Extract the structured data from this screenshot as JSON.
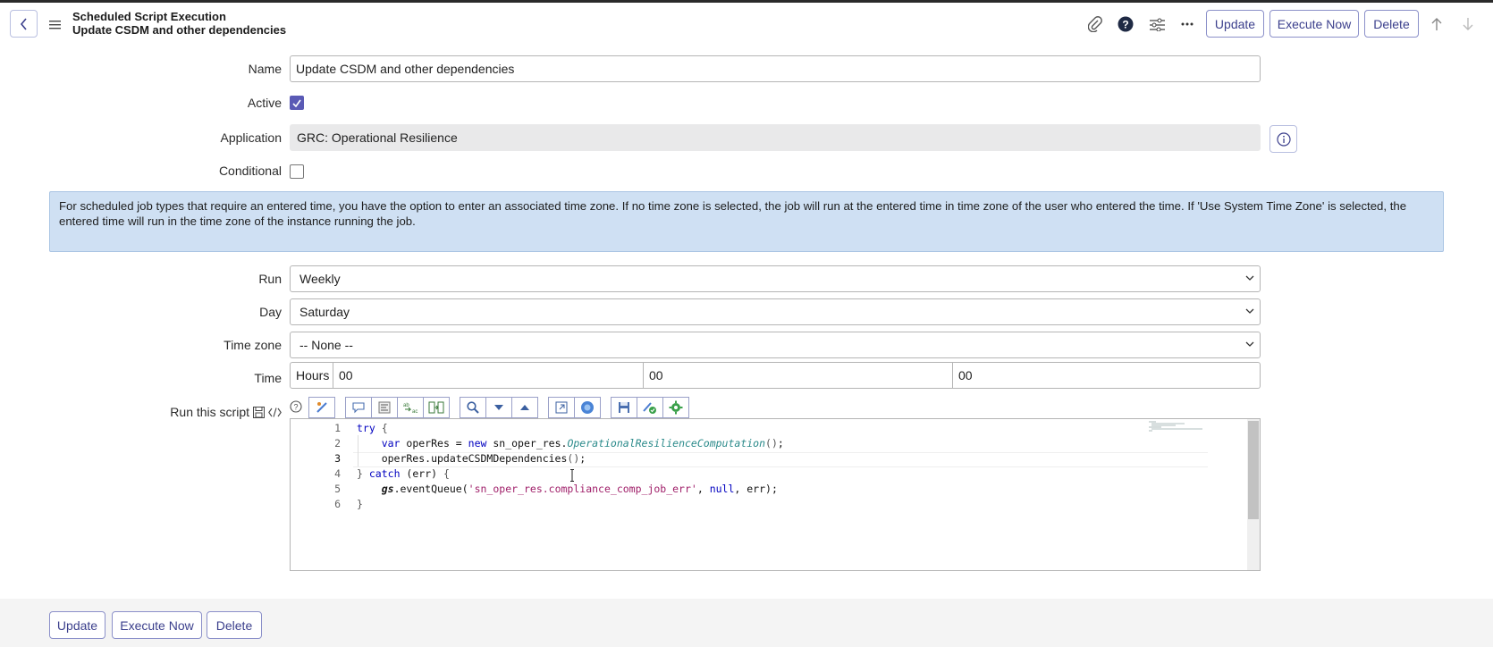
{
  "header": {
    "title": "Scheduled Script Execution",
    "subtitle": "Update CSDM and other dependencies",
    "buttons": {
      "update": "Update",
      "execute_now": "Execute Now",
      "delete": "Delete"
    }
  },
  "form": {
    "name": {
      "label": "Name",
      "value": "Update CSDM and other dependencies"
    },
    "active": {
      "label": "Active",
      "checked": true
    },
    "application": {
      "label": "Application",
      "value": "GRC: Operational Resilience"
    },
    "conditional": {
      "label": "Conditional",
      "checked": false
    },
    "info": "For scheduled job types that require an entered time, you have the option to enter an associated time zone. If no time zone is selected, the job will run at the entered time in time zone of the user who entered the time. If 'Use System Time Zone' is selected, the entered time will run in the time zone of the instance running the job.",
    "run": {
      "label": "Run",
      "value": "Weekly"
    },
    "day": {
      "label": "Day",
      "value": "Saturday"
    },
    "timezone": {
      "label": "Time zone",
      "value": "-- None --"
    },
    "time": {
      "label": "Time",
      "prefix": "Hours",
      "hours": "00",
      "minutes": "00",
      "seconds": "00"
    },
    "script": {
      "label": "Run this script",
      "line_numbers": [
        "1",
        "2",
        "3",
        "4",
        "5",
        "6"
      ]
    }
  },
  "footer": {
    "buttons": {
      "update": "Update",
      "execute_now": "Execute Now",
      "delete": "Delete"
    }
  },
  "colors": {
    "accent": "#3b3f8c",
    "info_bg": "#cfe0f3",
    "checkbox_on": "#5a5ab5"
  }
}
